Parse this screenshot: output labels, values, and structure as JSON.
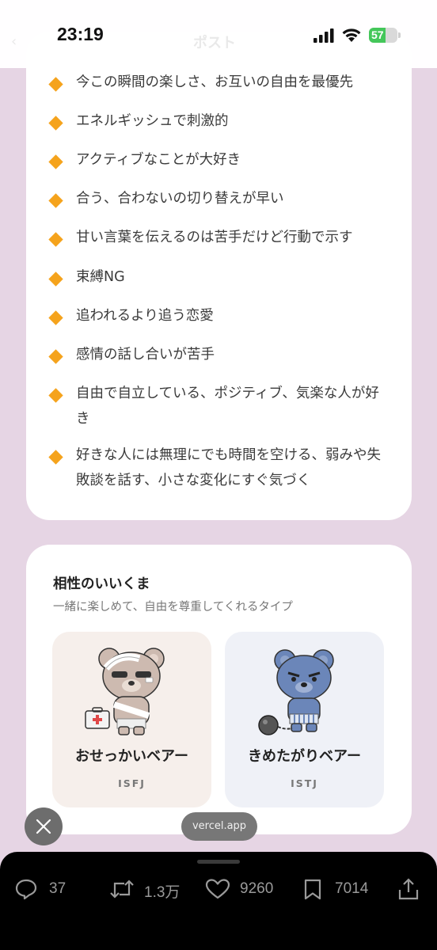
{
  "status_bar": {
    "time": "23:19",
    "battery_percent": "57",
    "battery_level": 0.57,
    "header_title": "ポスト",
    "back": "‹"
  },
  "traits": [
    "今この瞬間の楽しさ、お互いの自由を最優先",
    "エネルギッシュで刺激的",
    "アクティブなことが大好き",
    "合う、合わないの切り替えが早い",
    "甘い言葉を伝えるのは苦手だけど行動で示す",
    "束縛NG",
    "追われるより追う恋愛",
    "感情の話し合いが苦手",
    "自由で自立している、ポジティブ、気楽な人が好き",
    "好きな人には無理にでも時間を空ける、弱みや失敗談を話す、小さな変化にすぐ気づく"
  ],
  "compat": {
    "title": "相性のいいくま",
    "subtitle": "一緒に楽しめて、自由を尊重してくれるタイプ",
    "bears": [
      {
        "name": "おせっかいベアー",
        "type": "ISFJ"
      },
      {
        "name": "きめたがりベアー",
        "type": "ISTJ"
      }
    ]
  },
  "overlay": {
    "domain_pill": "vercel.app"
  },
  "actions": {
    "replies": "37",
    "reposts": "1.3万",
    "likes": "9260",
    "bookmarks": "7014"
  },
  "colors": {
    "background": "#e6d5e4",
    "bullet": "#f5a31c",
    "battery": "#44c75a"
  }
}
